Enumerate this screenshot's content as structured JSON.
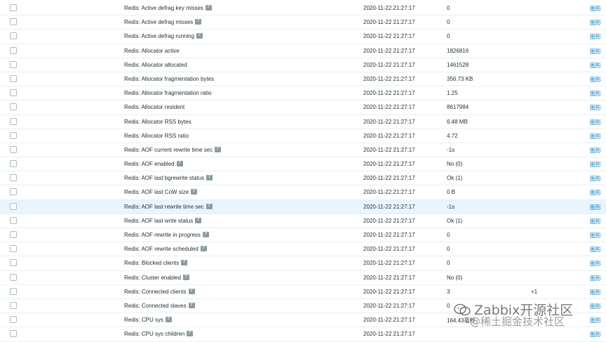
{
  "items": [
    {
      "name": "Redis: Active defrag key misses",
      "help": true,
      "time": "2020-11-22 21:27:17",
      "value": "0",
      "change": "",
      "link": "图形"
    },
    {
      "name": "Redis: Active defrag misses",
      "help": true,
      "time": "2020-11-22 21:27:17",
      "value": "0",
      "change": "",
      "link": "图形"
    },
    {
      "name": "Redis: Active defrag running",
      "help": true,
      "time": "2020-11-22 21:27:17",
      "value": "0",
      "change": "",
      "link": "图形"
    },
    {
      "name": "Redis: Allocator active",
      "help": false,
      "time": "2020-11-22 21:27:17",
      "value": "1826816",
      "change": "",
      "link": "图形"
    },
    {
      "name": "Redis: Allocator allocated",
      "help": false,
      "time": "2020-11-22 21:27:17",
      "value": "1461528",
      "change": "",
      "link": "图形"
    },
    {
      "name": "Redis: Allocator fragmentation bytes",
      "help": false,
      "time": "2020-11-22 21:27:17",
      "value": "356.73 KB",
      "change": "",
      "link": "图形"
    },
    {
      "name": "Redis: Allocator fragmentation ratio",
      "help": false,
      "time": "2020-11-22 21:27:17",
      "value": "1.25",
      "change": "",
      "link": "图形"
    },
    {
      "name": "Redis: Allocator resident",
      "help": false,
      "time": "2020-11-22 21:27:17",
      "value": "8617984",
      "change": "",
      "link": "图形"
    },
    {
      "name": "Redis: Allocator RSS bytes",
      "help": false,
      "time": "2020-11-22 21:27:17",
      "value": "6.48 MB",
      "change": "",
      "link": "图形"
    },
    {
      "name": "Redis: Allocator RSS ratio",
      "help": false,
      "time": "2020-11-22 21:27:17",
      "value": "4.72",
      "change": "",
      "link": "图形"
    },
    {
      "name": "Redis: AOF current rewrite time sec",
      "help": true,
      "time": "2020-11-22 21:27:17",
      "value": "-1s",
      "change": "",
      "link": "图形"
    },
    {
      "name": "Redis: AOF enabled",
      "help": true,
      "time": "2020-11-22 21:27:17",
      "value": "No (0)",
      "change": "",
      "link": "图形"
    },
    {
      "name": "Redis: AOF last bgrewrite status",
      "help": true,
      "time": "2020-11-22 21:27:17",
      "value": "Ok (1)",
      "change": "",
      "link": "图形"
    },
    {
      "name": "Redis: AOF last CoW size",
      "help": true,
      "time": "2020-11-22 21:27:17",
      "value": "0 B",
      "change": "",
      "link": "图形"
    },
    {
      "name": "Redis: AOF last rewrite time sec",
      "help": true,
      "time": "2020-11-22 21:27:17",
      "value": "-1s",
      "change": "",
      "link": "图形",
      "highlight": true
    },
    {
      "name": "Redis: AOF last write status",
      "help": true,
      "time": "2020-11-22 21:27:17",
      "value": "Ok (1)",
      "change": "",
      "link": "图形"
    },
    {
      "name": "Redis: AOF rewrite in progress",
      "help": true,
      "time": "2020-11-22 21:27:17",
      "value": "0",
      "change": "",
      "link": "图形"
    },
    {
      "name": "Redis: AOF rewrite scheduled",
      "help": true,
      "time": "2020-11-22 21:27:17",
      "value": "0",
      "change": "",
      "link": "图形"
    },
    {
      "name": "Redis: Blocked clients",
      "help": true,
      "time": "2020-11-22 21:27:17",
      "value": "0",
      "change": "",
      "link": "图形"
    },
    {
      "name": "Redis: Cluster enabled",
      "help": true,
      "time": "2020-11-22 21:27:17",
      "value": "No (0)",
      "change": "",
      "link": "图形"
    },
    {
      "name": "Redis: Connected clients",
      "help": true,
      "time": "2020-11-22 21:27:17",
      "value": "3",
      "change": "+1",
      "link": "图形"
    },
    {
      "name": "Redis: Connected slaves",
      "help": true,
      "time": "2020-11-22 21:27:17",
      "value": "0",
      "change": "",
      "link": "图形"
    },
    {
      "name": "Redis: CPU sys",
      "help": true,
      "time": "2020-11-22 21:27:17",
      "value": "164.43毫秒",
      "change": "",
      "link": "图形"
    },
    {
      "name": "Redis: CPU sys children",
      "help": true,
      "time": "2020-11-22 21:27:17",
      "value": "",
      "change": "",
      "link": "图形"
    }
  ],
  "watermark": {
    "line1": "Zabbix开源社区",
    "line2": "@稀土掘金技术社区"
  },
  "colors": {
    "link": "#0275b8",
    "highlight_row": "#e8f5ff",
    "help_icon": "#8a9ba3"
  }
}
